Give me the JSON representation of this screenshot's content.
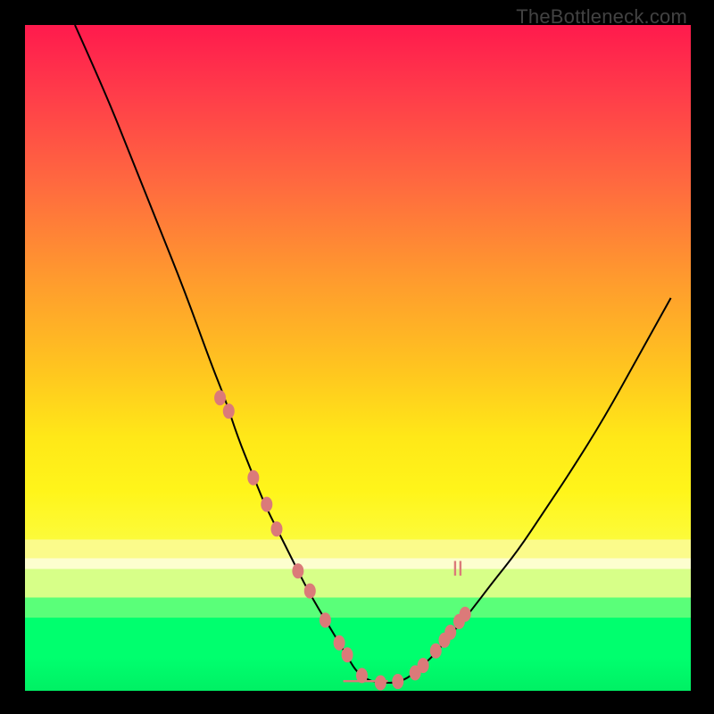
{
  "watermark": "TheBottleneck.com",
  "colors": {
    "marker": "#db7a79",
    "curve": "#000000",
    "frame": "#000000"
  },
  "chart_data": {
    "type": "line",
    "title": "",
    "xlabel": "",
    "ylabel": "",
    "xlim": [
      0,
      100
    ],
    "ylim": [
      0,
      100
    ],
    "grid": false,
    "curve": {
      "x": [
        7.5,
        12,
        16,
        20,
        24,
        28,
        30,
        32,
        34,
        36,
        38,
        40,
        42,
        44,
        45.5,
        47,
        48.5,
        49.5,
        50.5,
        52,
        54,
        55.5,
        56.8,
        58,
        60,
        62,
        64,
        67,
        70,
        74,
        78,
        82,
        87,
        92,
        97
      ],
      "y": [
        100,
        90,
        80,
        70,
        60,
        49,
        44,
        38,
        33,
        28,
        24,
        20,
        16,
        12.5,
        10,
        7.5,
        5,
        3.3,
        2.3,
        1.4,
        1.2,
        1.2,
        1.6,
        2.3,
        4,
        6,
        8.5,
        12,
        16,
        21,
        27,
        33,
        41,
        50,
        59
      ]
    },
    "markers": {
      "x": [
        29.3,
        30.6,
        34.3,
        36.3,
        37.8,
        41.0,
        42.8,
        45.1,
        47.2,
        48.4,
        50.6,
        53.4,
        56.0,
        58.6,
        59.8,
        61.7,
        63.0,
        63.9,
        65.2,
        66.1
      ],
      "y": [
        44.0,
        42.0,
        32.0,
        28.0,
        24.3,
        18.0,
        15.0,
        10.6,
        7.2,
        5.4,
        2.3,
        1.2,
        1.4,
        2.7,
        3.8,
        6.0,
        7.6,
        8.8,
        10.4,
        11.5
      ]
    },
    "ridge_segment": {
      "x": [
        47.8,
        54.5
      ],
      "y": [
        1.45,
        1.45
      ]
    },
    "small_ridge": {
      "x": [
        64.6,
        64.6,
        65.4,
        65.4
      ],
      "y": [
        17.3,
        19.5,
        17.3,
        19.5
      ]
    }
  }
}
